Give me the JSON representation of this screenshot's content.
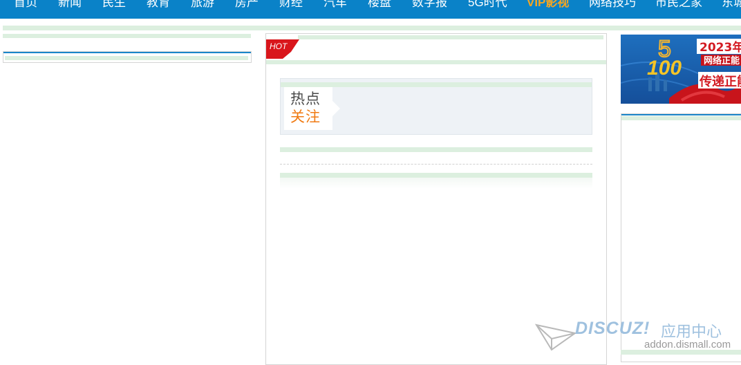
{
  "nav": {
    "items": [
      "首页",
      "新闻",
      "民生",
      "教育",
      "旅游",
      "房产",
      "财经",
      "汽车",
      "楼盘",
      "数字报",
      "5G时代",
      "VIP影视",
      "网络技巧",
      "市民之家",
      "东城"
    ],
    "highlight": "VIP影视",
    "bg_color": "#0a82c8",
    "highlight_color": "#f5a623"
  },
  "center": {
    "hot_tag": "HOT",
    "focus_title_line1": "热点",
    "focus_title_line2": "关注"
  },
  "banner": {
    "year": "2023年",
    "subtitle": "网络正能",
    "slogan": "传递正能",
    "logo_number": "100",
    "logo_small": "5"
  },
  "watermark": {
    "brand": "DISCUZ!",
    "brand_cn": "应用中心",
    "domain": "addon.dismall.com"
  },
  "colors": {
    "strip_green": "#dcefdf",
    "accent_blue": "#1a86c9",
    "hot_red": "#d9161c"
  }
}
